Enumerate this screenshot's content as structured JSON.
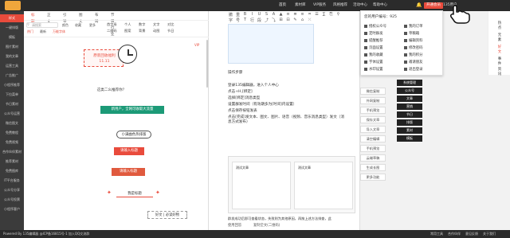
{
  "topbar": {
    "logo": "135",
    "nav": [
      "首页",
      "素材库",
      "VIP服务",
      "风格推荐",
      "活动中心",
      "帮助中心"
    ],
    "active_nav": "首页",
    "member_btn": "开通会员",
    "user": "135用户"
  },
  "sidebar": {
    "items": [
      "样式",
      "一键排版",
      "模板",
      "图片素材",
      "我的文章",
      "运营工具",
      "广告推广",
      "小程序推荐",
      "下拉菜单",
      "节日素材",
      "公众号运营",
      "微信图文",
      "免费教程",
      "免费视频",
      "合作伙伴素材",
      "推荐素材",
      "免费图库",
      "IT平台服务",
      "公众号分享",
      "公众号投票",
      "小程序客户"
    ],
    "active": "样式"
  },
  "panel": {
    "tabs": [
      "标题",
      "正文",
      "引导",
      "图文",
      "布局",
      "节日行业"
    ],
    "active_tab": "标题",
    "search_placeholder": "请搜索",
    "filters": [
      "颜色",
      "收藏",
      "更多"
    ],
    "tags": [
      "热门",
      "最新",
      "万能字体"
    ],
    "vip_tag": "VIP",
    "categories": [
      "首字母",
      "个人",
      "数字",
      "文字",
      "对比",
      "二维码",
      "图案",
      "背景",
      "动图",
      "节日"
    ],
    "samples": {
      "s1_line1": "原装回收福利",
      "s1_line2": "11.11",
      "s2": "这类二么推荐你？",
      "s3": "新用户，全网可收取大流量",
      "s4": "小满曲色热排版",
      "s5": "请输入标题",
      "s6": "请输入标题",
      "s7": "我是标题",
      "s8": "好文 | 必读好物"
    }
  },
  "editor": {
    "toolbar_row1": [
      "撤",
      "重",
      "B",
      "I",
      "U",
      "S",
      "A",
      "▲",
      "≡",
      "≣",
      "≡",
      "⌗",
      "☰",
      "∑",
      "⎘",
      "⚲"
    ],
    "toolbar_row2": [
      "字",
      "号",
      "T",
      "行",
      "段",
      "⤴",
      "⤵",
      "⊞",
      "⊟",
      "✎",
      "⌂",
      "⤫"
    ],
    "heading": "操作步骤",
    "steps": [
      "登录135编辑器，进入个人中心",
      "点击+H,[绑定]",
      "选择[绑定]消息类型",
      "设置群发时间（有效期多为[时间]内设置）",
      "点击保存按钮发表",
      "点击[完成]发文本、图文、图片、语音（视频、音乐消息类型）发文（消息方式发布）"
    ],
    "shot_card_title": "测试文章",
    "shot_cards": [
      "测试文章",
      "测试文章"
    ],
    "after_text_1": "群发成功后即可查看状态，失败则为其他原因，再按上述方法排查，此",
    "after_text_2": "次使用时请按照上面说...",
    "bottom_tools": [
      "使用回答",
      "复制全文(二维码)"
    ]
  },
  "right_actions": [
    "微信复制",
    "外网复制",
    "手机预览",
    "保存文章",
    "导入文章",
    "清空编辑",
    "手机预览",
    "云端草稿",
    "生成长图",
    "更多功能"
  ],
  "dropdown": {
    "uid_label": "您的用户编号：925",
    "items": [
      [
        "授权公众号",
        "我的订单"
      ],
      [
        "定时群发",
        "草稿箱"
      ],
      [
        "提醒推荐",
        "编辑资料"
      ],
      [
        "页面设置",
        "修改密码"
      ],
      [
        "我的收藏",
        "我的积分"
      ],
      [
        "字体设置",
        "邀请朋友"
      ],
      [
        "水印设置",
        "退出登录"
      ]
    ]
  },
  "dark_buttons": [
    "系统管理",
    "公众号",
    "文章",
    "营销",
    "节日",
    "排版",
    "素材",
    "模板"
  ],
  "side_strip": [
    "热点",
    "元素",
    "好文",
    "事件",
    "资讯"
  ],
  "footer": {
    "left": "Powered By 135编辑器  @ICP备16815号-1  加入QQ交流群",
    "right_items": [
      "常用工具",
      "合作伙伴",
      "意见反馈",
      "关于我们"
    ]
  }
}
